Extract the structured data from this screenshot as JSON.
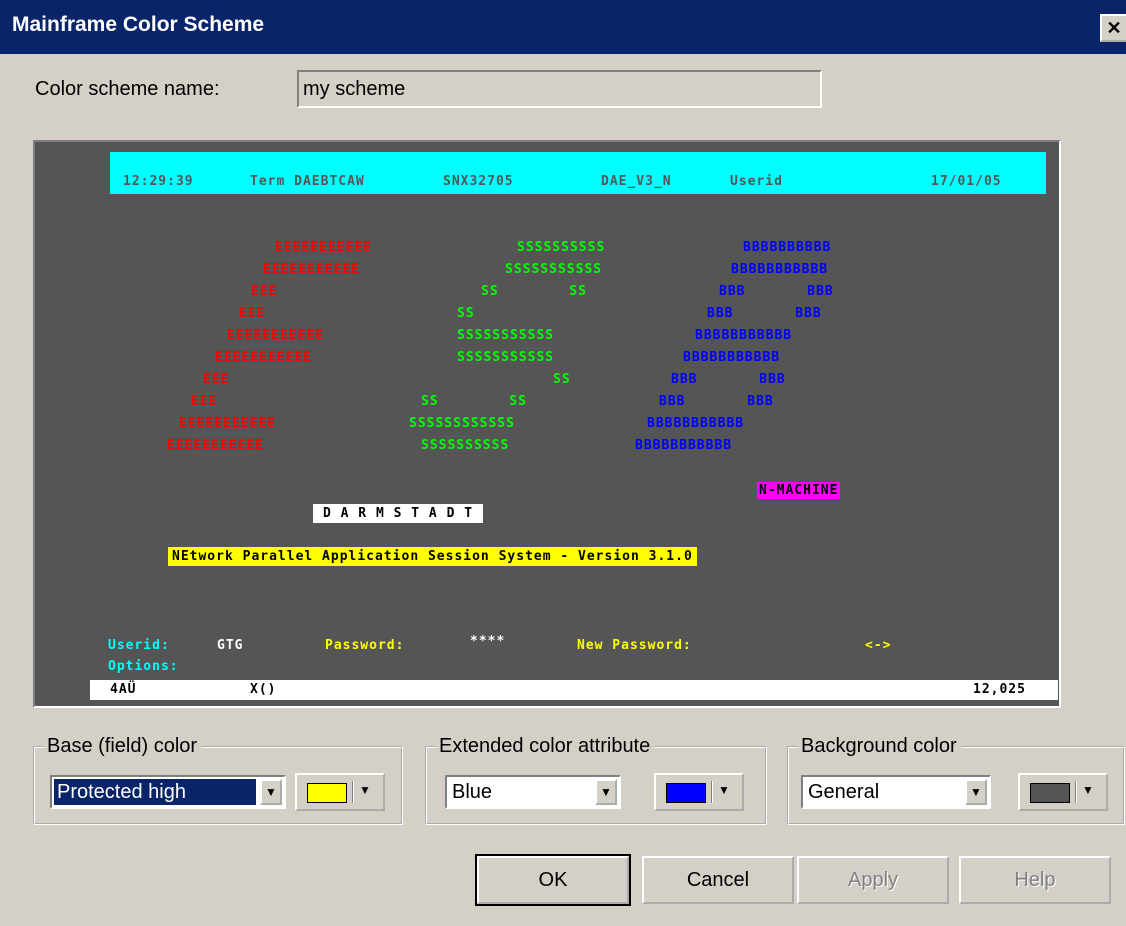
{
  "window": {
    "title": "Mainframe Color Scheme",
    "close_glyph": "✕"
  },
  "scheme": {
    "label": "Color scheme name:",
    "value": "my scheme"
  },
  "terminal": {
    "header": {
      "time": "12:29:39",
      "term": "Term DAEBTCAW",
      "node": "SNX32705",
      "session": "DAE_V3_N",
      "user": "Userid",
      "date": "17/01/05"
    },
    "logo_red": [
      "EEEEEEEEEEE",
      "EEEEEEEEEEE",
      "EEE",
      "EEE",
      "EEEEEEEEEEE",
      "EEEEEEEEEEE",
      "EEE",
      "EEE",
      "EEEEEEEEEEE",
      "EEEEEEEEEEE"
    ],
    "logo_green": [
      "SSSSSSSSSS",
      "SSSSSSSSSSS",
      "SS        SS",
      "SS",
      "SSSSSSSSSSS",
      "SSSSSSSSSSS",
      "SS",
      "SS        SS",
      "SSSSSSSSSSSS",
      "SSSSSSSSSS"
    ],
    "logo_blue": [
      "BBBBBBBBBB",
      "BBBBBBBBBBB",
      "BBB       BBB",
      "BBB       BBB",
      "BBBBBBBBBBB",
      "BBBBBBBBBBB",
      "BBB       BBB",
      "BBB       BBB",
      "BBBBBBBBBBB",
      "BBBBBBBBBBB"
    ],
    "machine": "N-MACHINE",
    "city": "D A R M S T A D T",
    "banner": "NEtwork Parallel Application Session System - Version 3.1.0",
    "userid_label": "Userid:",
    "userid_value": "GTG",
    "password_label": "Password:",
    "password_value": "****",
    "new_password_label": "New Password:",
    "arrow": "<->",
    "options_label": "Options:",
    "status_left": "4AÜ",
    "status_mid": "X()",
    "status_right": "12,025",
    "colors": {
      "background": "#555555",
      "header_bar": "#00ffff",
      "red": "#ff0000",
      "green": "#00ff00",
      "blue": "#0000ff",
      "magenta": "#ff00ff",
      "yellow": "#ffff00"
    }
  },
  "base_color": {
    "legend": "Base (field) color",
    "selected": "Protected high",
    "swatch": "#ffff00"
  },
  "extended_color": {
    "legend": "Extended color attribute",
    "selected": "Blue",
    "swatch": "#0000ff"
  },
  "background_color": {
    "legend": "Background color",
    "selected": "General",
    "swatch": "#555555"
  },
  "buttons": {
    "ok": "OK",
    "cancel": "Cancel",
    "apply": "Apply",
    "help": "Help"
  }
}
